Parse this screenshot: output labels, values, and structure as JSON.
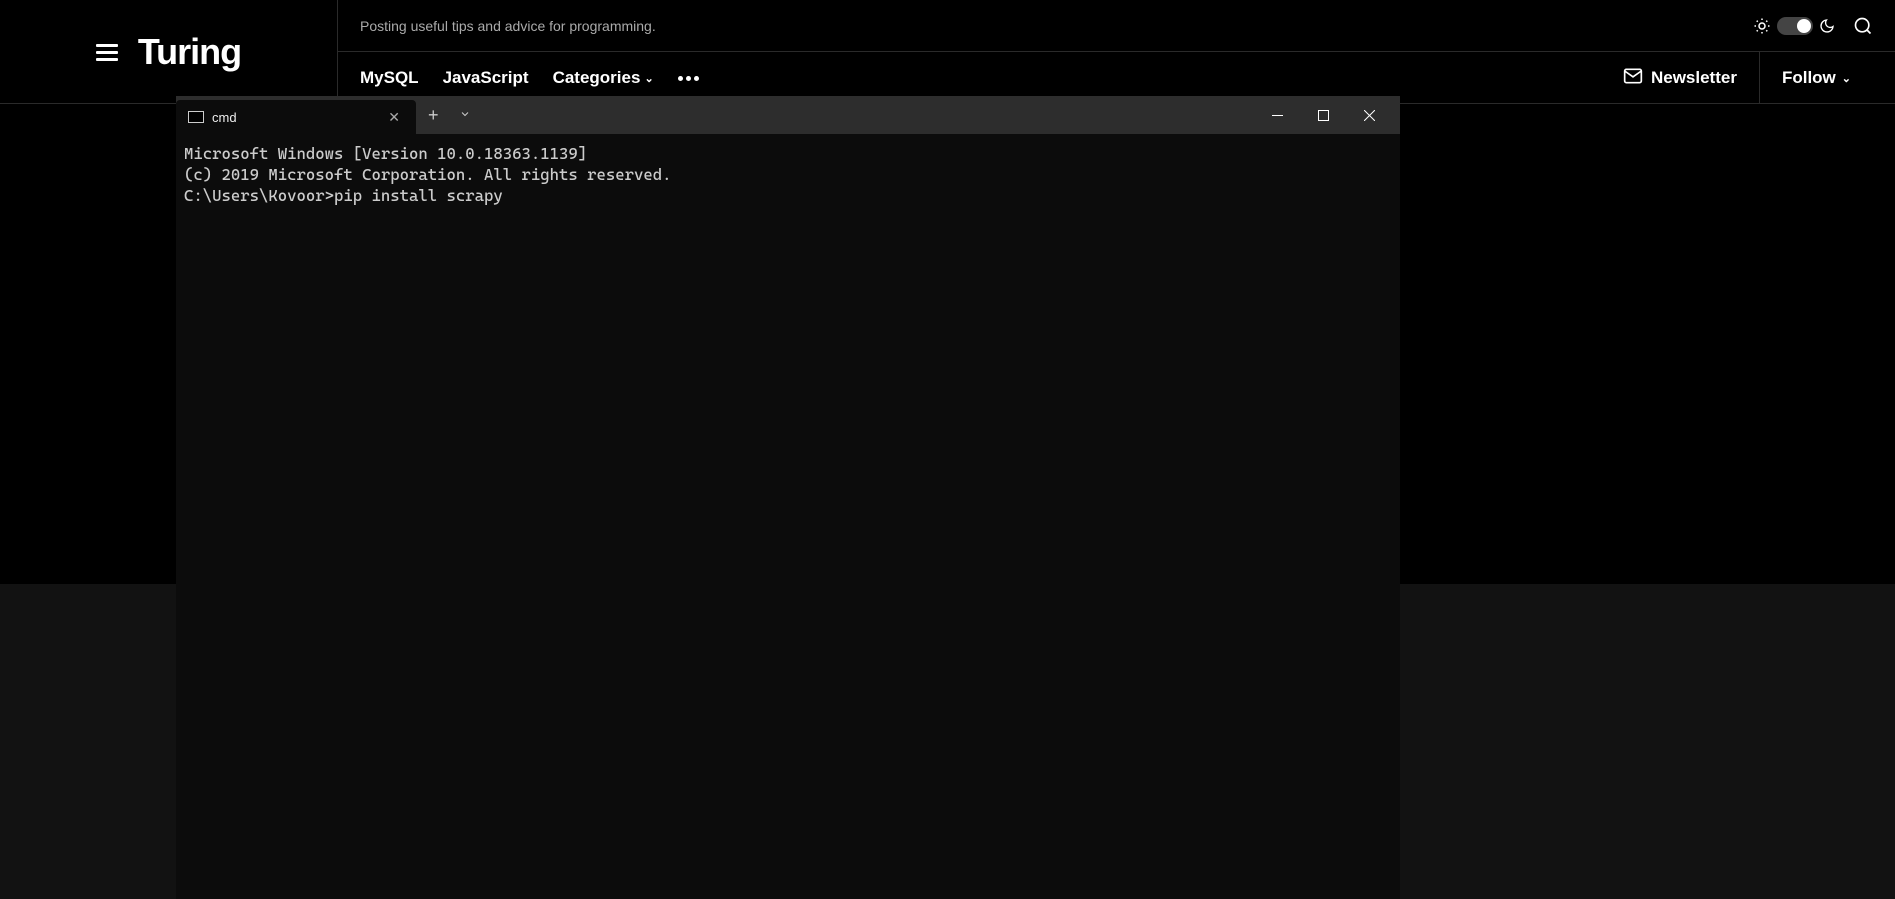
{
  "header": {
    "logo": "Turing",
    "tagline": "Posting useful tips and advice for programming."
  },
  "nav": {
    "items": [
      {
        "label": "MySQL"
      },
      {
        "label": "JavaScript"
      },
      {
        "label": "Categories"
      }
    ],
    "newsletter": "Newsletter",
    "follow": "Follow"
  },
  "terminal": {
    "tab_title": "cmd",
    "lines": [
      "Microsoft Windows [Version 10.0.18363.1139]",
      "(c) 2019 Microsoft Corporation. All rights reserved.",
      "",
      "C:\\Users\\Kovoor>pip install scrapy"
    ]
  }
}
